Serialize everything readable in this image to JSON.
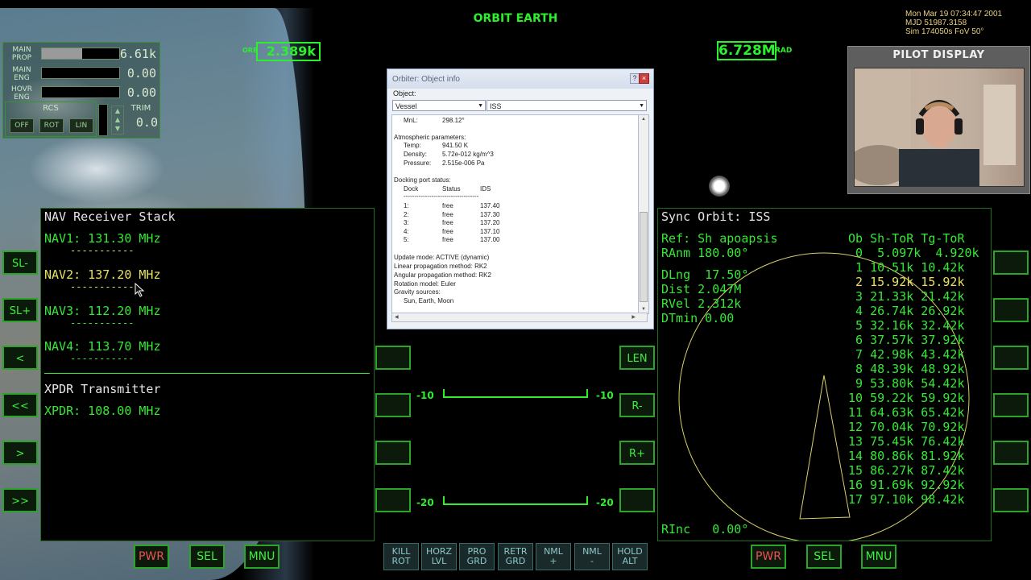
{
  "hud": {
    "title": "ORBIT EARTH",
    "velocity_prefix": "ORB",
    "velocity": "2.389k",
    "radius": "6.728M",
    "radius_unit": "RAD",
    "datetime": [
      "Mon Mar 19 07:34:47 2001",
      "MJD 51987.3158",
      "Sim  174050s        FoV  50°"
    ]
  },
  "engine_panel": {
    "main_prop_label": "MAIN PROP",
    "main_prop_value": "6.61k",
    "main_prop_fill": 0.52,
    "main_eng_label": "MAIN ENG",
    "main_eng_value": "0.00",
    "hovr_eng_label": "HOVR ENG",
    "hovr_eng_value": "0.00",
    "rcs_label": "RCS",
    "rcs_off": "OFF",
    "rcs_rot": "ROT",
    "rcs_lin": "LIN",
    "trim_label": "TRIM",
    "trim_value": "0.0"
  },
  "pilot_display": {
    "title": "PILOT DISPLAY"
  },
  "left_mfd": {
    "nav_title": "NAV Receiver Stack",
    "nav1": "NAV1: 131.30 MHz",
    "nav2": "NAV2: 137.20 MHz",
    "nav3": "NAV3: 112.20 MHz",
    "nav4": "NAV4: 113.70 MHz",
    "dashes": "-----------",
    "xpdr_title": "XPDR Transmitter",
    "xpdr": "XPDR: 108.00 MHz",
    "side_buttons": [
      "SL-",
      "SL+",
      "<",
      "<<",
      ">",
      ">>"
    ],
    "bottom_buttons": [
      "PWR",
      "SEL",
      "MNU"
    ]
  },
  "right_mfd": {
    "title": "Sync Orbit: ISS",
    "ref": "Ref: Sh apoapsis",
    "ranm": "RAnm 180.00°",
    "dlng": "DLng  17.50°",
    "dist": "Dist 2.047M",
    "rvel": "RVel 2.312k",
    "dtmin": "DTmin 0.00",
    "rinc": "RInc   0.00°",
    "table_header": "Ob Sh-ToR Tg-ToR",
    "rows": [
      " 0  5.097k  4.920k",
      " 1 10.51k 10.42k",
      " 2 15.92k 15.92k",
      " 3 21.33k 21.42k",
      " 4 26.74k 26.92k",
      " 5 32.16k 32.42k",
      " 6 37.57k 37.92k",
      " 7 42.98k 43.42k",
      " 8 48.39k 48.92k",
      " 9 53.80k 54.42k",
      "10 59.22k 59.92k",
      "11 64.63k 65.42k",
      "12 70.04k 70.92k",
      "13 75.45k 76.42k",
      "14 80.86k 81.92k",
      "15 86.27k 87.42k",
      "16 91.69k 92.92k",
      "17 97.10k 98.42k"
    ],
    "side_buttons_left": [
      "LEN",
      "R-",
      "R+"
    ],
    "bottom_buttons": [
      "PWR",
      "SEL",
      "MNU"
    ]
  },
  "center": {
    "pitch_neg10": "-10",
    "pitch_neg20": "-20"
  },
  "autopilot_buttons": [
    [
      "KILL",
      "ROT"
    ],
    [
      "HORZ",
      "LVL"
    ],
    [
      "PRO",
      "GRD"
    ],
    [
      "RETR",
      "GRD"
    ],
    [
      "NML",
      "+"
    ],
    [
      "NML",
      "-"
    ],
    [
      "HOLD",
      "ALT"
    ]
  ],
  "dialog": {
    "title": "Orbiter: Object info",
    "help": "?",
    "close": "×",
    "object_label": "Object:",
    "type_select": "Vessel",
    "name_select": "ISS",
    "lines": {
      "mnl": "MnL:",
      "mnl_val": "298.12°",
      "atm": "Atmospheric parameters:",
      "temp": "Temp:",
      "temp_val": "941.50 K",
      "density": "Density:",
      "density_val": "5.72e-012 kg/m^3",
      "pressure": "Pressure:",
      "pressure_val": "2.515e-006 Pa",
      "dock_status": "Docking port status:",
      "dock_hdr": [
        "Dock",
        "Status",
        "IDS"
      ],
      "dock_sep": "-----------------------------------",
      "docks": [
        [
          "1:",
          "free",
          "137.40"
        ],
        [
          "2:",
          "free",
          "137.30"
        ],
        [
          "3:",
          "free",
          "137.20"
        ],
        [
          "4:",
          "free",
          "137.10"
        ],
        [
          "5:",
          "free",
          "137.00"
        ]
      ],
      "update_mode": "Update mode: ACTIVE (dynamic)",
      "lin_prop": "Linear propagation method: RK2",
      "ang_prop": "Angular propagation method: RK2",
      "rot_model": "Rotation model: Euler",
      "grav": "Gravity sources:",
      "grav_list": "Sun, Earth, Moon"
    }
  },
  "colors": {
    "mfd_green": "#34e834",
    "mfd_yellow": "#e8e060",
    "hud_green": "#2cf02c",
    "button_red": "#f05050"
  }
}
